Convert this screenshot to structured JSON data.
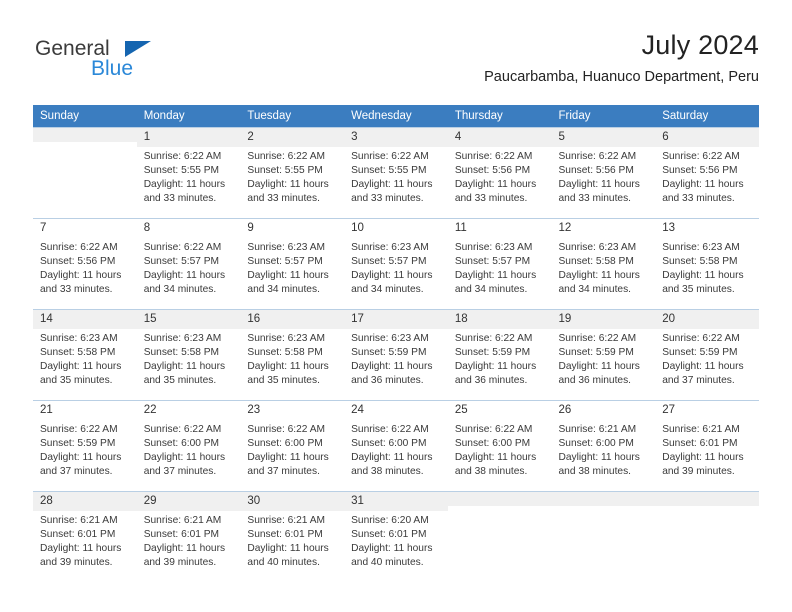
{
  "brand": {
    "name_part1": "General",
    "name_part2": "Blue",
    "color_dark": "#3b3b3b",
    "color_blue": "#2b88d8",
    "triangle_color": "#1565b0"
  },
  "header": {
    "title": "July 2024",
    "subtitle": "Paucarbamba, Huanuco Department, Peru"
  },
  "theme": {
    "header_row_bg": "#3b7dc0",
    "header_row_text": "#ffffff",
    "daynum_shade_bg": "#f0f0f0",
    "grid_line": "#b9cfe4"
  },
  "weekdays": [
    "Sunday",
    "Monday",
    "Tuesday",
    "Wednesday",
    "Thursday",
    "Friday",
    "Saturday"
  ],
  "weeks": [
    {
      "shaded": true,
      "days": [
        {
          "num": "",
          "sunrise": "",
          "sunset": "",
          "daylight1": "",
          "daylight2": ""
        },
        {
          "num": "1",
          "sunrise": "Sunrise: 6:22 AM",
          "sunset": "Sunset: 5:55 PM",
          "daylight1": "Daylight: 11 hours",
          "daylight2": "and 33 minutes."
        },
        {
          "num": "2",
          "sunrise": "Sunrise: 6:22 AM",
          "sunset": "Sunset: 5:55 PM",
          "daylight1": "Daylight: 11 hours",
          "daylight2": "and 33 minutes."
        },
        {
          "num": "3",
          "sunrise": "Sunrise: 6:22 AM",
          "sunset": "Sunset: 5:55 PM",
          "daylight1": "Daylight: 11 hours",
          "daylight2": "and 33 minutes."
        },
        {
          "num": "4",
          "sunrise": "Sunrise: 6:22 AM",
          "sunset": "Sunset: 5:56 PM",
          "daylight1": "Daylight: 11 hours",
          "daylight2": "and 33 minutes."
        },
        {
          "num": "5",
          "sunrise": "Sunrise: 6:22 AM",
          "sunset": "Sunset: 5:56 PM",
          "daylight1": "Daylight: 11 hours",
          "daylight2": "and 33 minutes."
        },
        {
          "num": "6",
          "sunrise": "Sunrise: 6:22 AM",
          "sunset": "Sunset: 5:56 PM",
          "daylight1": "Daylight: 11 hours",
          "daylight2": "and 33 minutes."
        }
      ]
    },
    {
      "shaded": false,
      "days": [
        {
          "num": "7",
          "sunrise": "Sunrise: 6:22 AM",
          "sunset": "Sunset: 5:56 PM",
          "daylight1": "Daylight: 11 hours",
          "daylight2": "and 33 minutes."
        },
        {
          "num": "8",
          "sunrise": "Sunrise: 6:22 AM",
          "sunset": "Sunset: 5:57 PM",
          "daylight1": "Daylight: 11 hours",
          "daylight2": "and 34 minutes."
        },
        {
          "num": "9",
          "sunrise": "Sunrise: 6:23 AM",
          "sunset": "Sunset: 5:57 PM",
          "daylight1": "Daylight: 11 hours",
          "daylight2": "and 34 minutes."
        },
        {
          "num": "10",
          "sunrise": "Sunrise: 6:23 AM",
          "sunset": "Sunset: 5:57 PM",
          "daylight1": "Daylight: 11 hours",
          "daylight2": "and 34 minutes."
        },
        {
          "num": "11",
          "sunrise": "Sunrise: 6:23 AM",
          "sunset": "Sunset: 5:57 PM",
          "daylight1": "Daylight: 11 hours",
          "daylight2": "and 34 minutes."
        },
        {
          "num": "12",
          "sunrise": "Sunrise: 6:23 AM",
          "sunset": "Sunset: 5:58 PM",
          "daylight1": "Daylight: 11 hours",
          "daylight2": "and 34 minutes."
        },
        {
          "num": "13",
          "sunrise": "Sunrise: 6:23 AM",
          "sunset": "Sunset: 5:58 PM",
          "daylight1": "Daylight: 11 hours",
          "daylight2": "and 35 minutes."
        }
      ]
    },
    {
      "shaded": true,
      "days": [
        {
          "num": "14",
          "sunrise": "Sunrise: 6:23 AM",
          "sunset": "Sunset: 5:58 PM",
          "daylight1": "Daylight: 11 hours",
          "daylight2": "and 35 minutes."
        },
        {
          "num": "15",
          "sunrise": "Sunrise: 6:23 AM",
          "sunset": "Sunset: 5:58 PM",
          "daylight1": "Daylight: 11 hours",
          "daylight2": "and 35 minutes."
        },
        {
          "num": "16",
          "sunrise": "Sunrise: 6:23 AM",
          "sunset": "Sunset: 5:58 PM",
          "daylight1": "Daylight: 11 hours",
          "daylight2": "and 35 minutes."
        },
        {
          "num": "17",
          "sunrise": "Sunrise: 6:23 AM",
          "sunset": "Sunset: 5:59 PM",
          "daylight1": "Daylight: 11 hours",
          "daylight2": "and 36 minutes."
        },
        {
          "num": "18",
          "sunrise": "Sunrise: 6:22 AM",
          "sunset": "Sunset: 5:59 PM",
          "daylight1": "Daylight: 11 hours",
          "daylight2": "and 36 minutes."
        },
        {
          "num": "19",
          "sunrise": "Sunrise: 6:22 AM",
          "sunset": "Sunset: 5:59 PM",
          "daylight1": "Daylight: 11 hours",
          "daylight2": "and 36 minutes."
        },
        {
          "num": "20",
          "sunrise": "Sunrise: 6:22 AM",
          "sunset": "Sunset: 5:59 PM",
          "daylight1": "Daylight: 11 hours",
          "daylight2": "and 37 minutes."
        }
      ]
    },
    {
      "shaded": false,
      "days": [
        {
          "num": "21",
          "sunrise": "Sunrise: 6:22 AM",
          "sunset": "Sunset: 5:59 PM",
          "daylight1": "Daylight: 11 hours",
          "daylight2": "and 37 minutes."
        },
        {
          "num": "22",
          "sunrise": "Sunrise: 6:22 AM",
          "sunset": "Sunset: 6:00 PM",
          "daylight1": "Daylight: 11 hours",
          "daylight2": "and 37 minutes."
        },
        {
          "num": "23",
          "sunrise": "Sunrise: 6:22 AM",
          "sunset": "Sunset: 6:00 PM",
          "daylight1": "Daylight: 11 hours",
          "daylight2": "and 37 minutes."
        },
        {
          "num": "24",
          "sunrise": "Sunrise: 6:22 AM",
          "sunset": "Sunset: 6:00 PM",
          "daylight1": "Daylight: 11 hours",
          "daylight2": "and 38 minutes."
        },
        {
          "num": "25",
          "sunrise": "Sunrise: 6:22 AM",
          "sunset": "Sunset: 6:00 PM",
          "daylight1": "Daylight: 11 hours",
          "daylight2": "and 38 minutes."
        },
        {
          "num": "26",
          "sunrise": "Sunrise: 6:21 AM",
          "sunset": "Sunset: 6:00 PM",
          "daylight1": "Daylight: 11 hours",
          "daylight2": "and 38 minutes."
        },
        {
          "num": "27",
          "sunrise": "Sunrise: 6:21 AM",
          "sunset": "Sunset: 6:01 PM",
          "daylight1": "Daylight: 11 hours",
          "daylight2": "and 39 minutes."
        }
      ]
    },
    {
      "shaded": true,
      "days": [
        {
          "num": "28",
          "sunrise": "Sunrise: 6:21 AM",
          "sunset": "Sunset: 6:01 PM",
          "daylight1": "Daylight: 11 hours",
          "daylight2": "and 39 minutes."
        },
        {
          "num": "29",
          "sunrise": "Sunrise: 6:21 AM",
          "sunset": "Sunset: 6:01 PM",
          "daylight1": "Daylight: 11 hours",
          "daylight2": "and 39 minutes."
        },
        {
          "num": "30",
          "sunrise": "Sunrise: 6:21 AM",
          "sunset": "Sunset: 6:01 PM",
          "daylight1": "Daylight: 11 hours",
          "daylight2": "and 40 minutes."
        },
        {
          "num": "31",
          "sunrise": "Sunrise: 6:20 AM",
          "sunset": "Sunset: 6:01 PM",
          "daylight1": "Daylight: 11 hours",
          "daylight2": "and 40 minutes."
        },
        {
          "num": "",
          "sunrise": "",
          "sunset": "",
          "daylight1": "",
          "daylight2": ""
        },
        {
          "num": "",
          "sunrise": "",
          "sunset": "",
          "daylight1": "",
          "daylight2": ""
        },
        {
          "num": "",
          "sunrise": "",
          "sunset": "",
          "daylight1": "",
          "daylight2": ""
        }
      ]
    }
  ]
}
